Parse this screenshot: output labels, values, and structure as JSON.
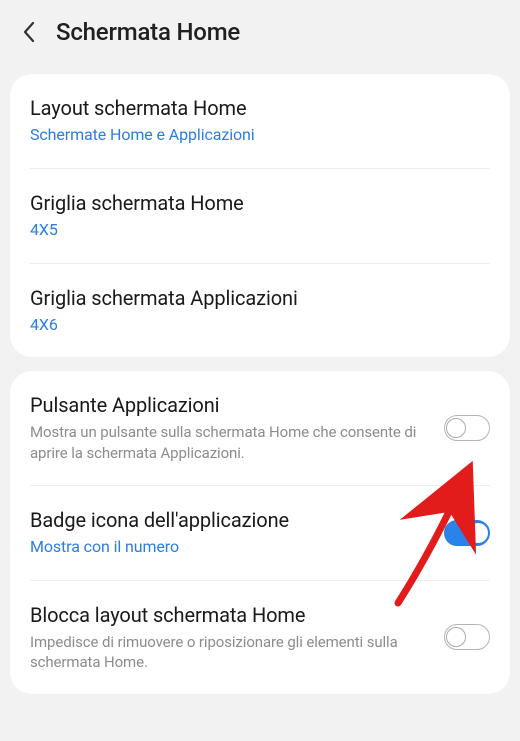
{
  "header": {
    "title": "Schermata Home"
  },
  "group1": {
    "row1": {
      "title": "Layout schermata Home",
      "sub": "Schermate Home e Applicazioni"
    },
    "row2": {
      "title": "Griglia schermata Home",
      "sub": "4X5"
    },
    "row3": {
      "title": "Griglia schermata Applicazioni",
      "sub": "4X6"
    }
  },
  "group2": {
    "row1": {
      "title": "Pulsante Applicazioni",
      "desc": "Mostra un pulsante sulla schermata Home che consente di aprire la schermata Applicazioni.",
      "toggle": false
    },
    "row2": {
      "title": "Badge icona dell'applicazione",
      "sub": "Mostra con il numero",
      "toggle": true
    },
    "row3": {
      "title": "Blocca layout schermata Home",
      "desc": "Impedisce di rimuovere o riposizionare gli elementi sulla schermata Home.",
      "toggle": false
    }
  }
}
